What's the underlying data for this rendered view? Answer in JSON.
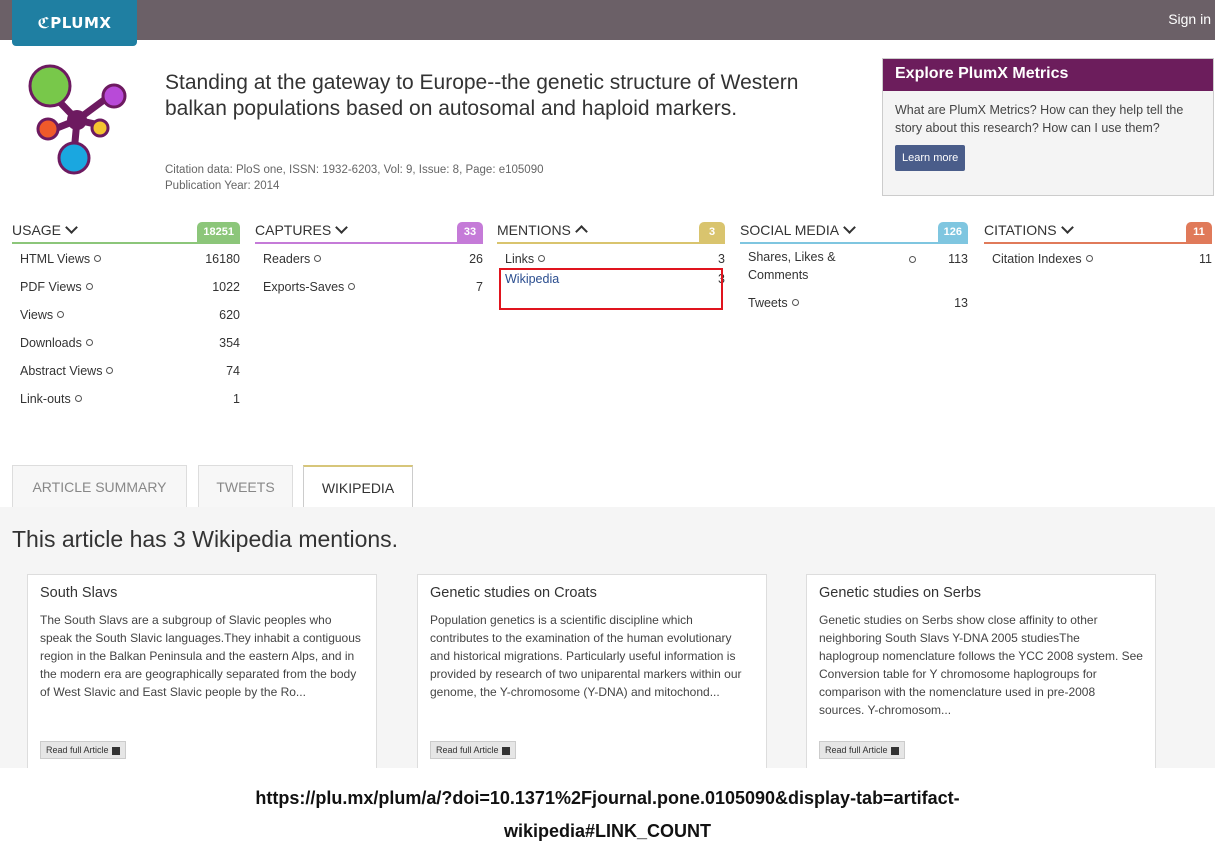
{
  "topbar": {
    "logo_text": "ℭPLUMX",
    "signin_label": "Sign in"
  },
  "article": {
    "title": "Standing at the gateway to Europe--the genetic structure of Western balkan populations based on autosomal and haploid markers.",
    "citation": "Citation data: PloS one, ISSN: 1932-6203, Vol: 9, Issue: 8, Page: e105090",
    "year": "Publication Year: 2014"
  },
  "explore": {
    "title": "Explore PlumX Metrics",
    "body": "What are PlumX Metrics? How can they help tell the story about this research? How can I use them?",
    "button": "Learn more"
  },
  "metrics": {
    "usage": {
      "label": "USAGE",
      "count": "18251",
      "color": "#8cc67a",
      "rows": [
        {
          "label": "HTML Views",
          "value": "16180"
        },
        {
          "label": "PDF Views",
          "value": "1022"
        },
        {
          "label": "Views",
          "value": "620"
        },
        {
          "label": "Downloads",
          "value": "354"
        },
        {
          "label": "Abstract Views",
          "value": "74"
        },
        {
          "label": "Link-outs",
          "value": "1"
        }
      ]
    },
    "captures": {
      "label": "CAPTURES",
      "count": "33",
      "color": "#c57bd8",
      "rows": [
        {
          "label": "Readers",
          "value": "26"
        },
        {
          "label": "Exports-Saves",
          "value": "7"
        }
      ]
    },
    "mentions": {
      "label": "MENTIONS",
      "count": "3",
      "color": "#d9c46e",
      "rows": [
        {
          "label": "Links",
          "value": "3"
        },
        {
          "label": "Wikipedia",
          "value": "3"
        }
      ]
    },
    "social": {
      "label": "SOCIAL MEDIA",
      "count": "126",
      "color": "#7fc6e0",
      "rows": [
        {
          "label": "Shares, Likes & Comments",
          "value": "113"
        },
        {
          "label": "Tweets",
          "value": "13"
        }
      ]
    },
    "citations": {
      "label": "CITATIONS",
      "count": "11",
      "color": "#e07a5a",
      "rows": [
        {
          "label": "Citation Indexes",
          "value": "11"
        }
      ]
    }
  },
  "tabs": [
    "ARTICLE SUMMARY",
    "TWEETS",
    "WIKIPEDIA"
  ],
  "mentions_title": "This article has 3 Wikipedia mentions.",
  "cards": [
    {
      "title": "South Slavs",
      "text": "The South Slavs are a subgroup of Slavic peoples who speak the South Slavic languages.They inhabit a contiguous region in the Balkan Peninsula and the eastern Alps, and in the modern era are geographically separated from the body of West Slavic and East Slavic people by the Ro...",
      "button": "Read full Article"
    },
    {
      "title": "Genetic studies on Croats",
      "text": "Population genetics is a scientific discipline which contributes to the examination of the human evolutionary and historical migrations. Particularly useful information is provided by research of two uniparental markers within our genome, the Y-chromosome (Y-DNA) and mitochond...",
      "button": "Read full Article"
    },
    {
      "title": "Genetic studies on Serbs",
      "text": "Genetic studies on Serbs show close affinity to other neighboring South Slavs Y-DNA 2005 studiesThe haplogroup nomenclature follows the YCC 2008 system. See Conversion table for Y chromosome haplogroups for comparison with the nomenclature used in pre-2008 sources. Y-chromosom...",
      "button": "Read full Article"
    }
  ],
  "url_caption": {
    "line1": "https://plu.mx/plum/a/?doi=10.1371%2Fjournal.pone.0105090&display-tab=artifact-",
    "line2": "wikipedia#LINK_COUNT"
  }
}
